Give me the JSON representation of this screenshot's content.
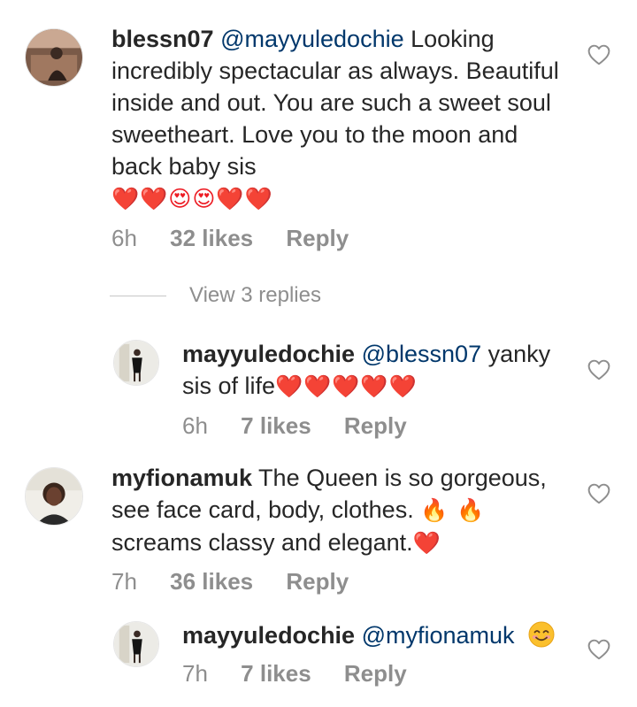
{
  "comments": [
    {
      "username": "blessn07",
      "mention": "@mayyuledochie",
      "text": " Looking incredibly spectacular as always. Beautiful inside and out. You are such a sweet soul sweetheart. Love you to the moon and back baby sis",
      "emojis": "❤️❤️😍😍❤️❤️",
      "time": "6h",
      "likes": "32 likes",
      "reply_label": "Reply",
      "view_replies": "View 3 replies"
    },
    {
      "username": "mayyuledochie",
      "mention": "@blessn07",
      "text": " yanky sis of life",
      "emojis": "❤️❤️❤️❤️❤️",
      "time": "6h",
      "likes": "7 likes",
      "reply_label": "Reply"
    },
    {
      "username": "myfionamuk",
      "text_line1": " The Queen is so gorgeous, see face card, body, clothes.",
      "fire": "🔥 🔥",
      "text_line2": " screams classy and elegant.",
      "heart": "❤️",
      "time": "7h",
      "likes": "36 likes",
      "reply_label": "Reply"
    },
    {
      "username": "mayyuledochie",
      "mention": "@myfionamuk",
      "emoji_icon": "smiling-face-icon",
      "time": "7h",
      "likes": "7 likes",
      "reply_label": "Reply"
    }
  ],
  "icons": {
    "like": "heart-outline-icon"
  },
  "colors": {
    "mention": "#00376b",
    "meta": "#8e8e8e",
    "heart": "#ed1c24"
  }
}
